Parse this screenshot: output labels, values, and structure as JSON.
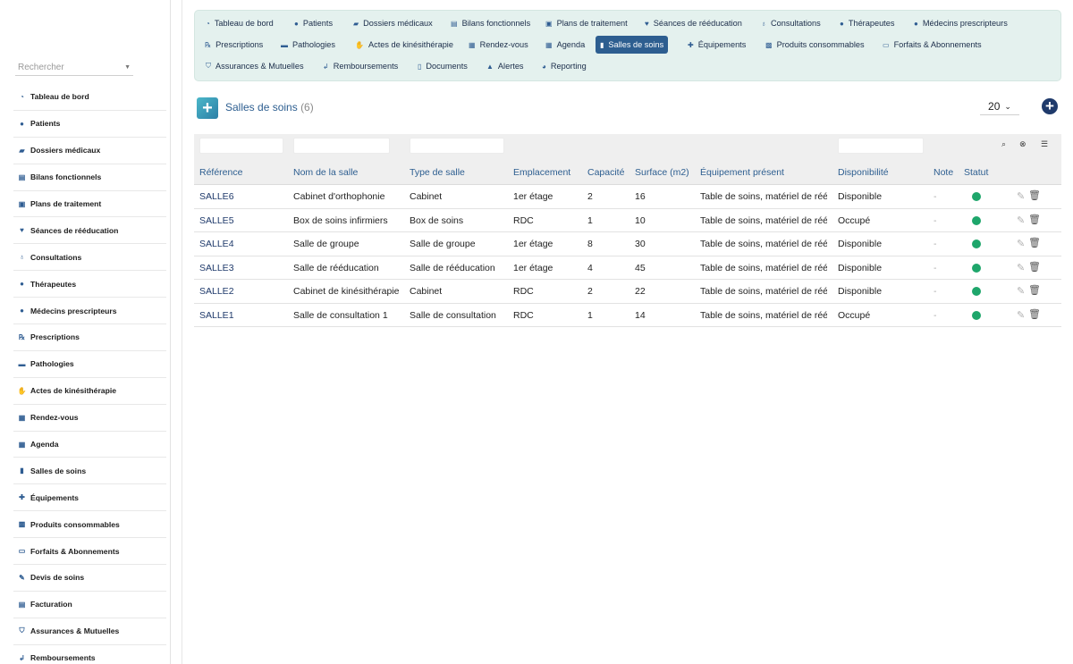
{
  "search": {
    "placeholder": "Rechercher"
  },
  "sidebar": {
    "items": [
      {
        "label": "Tableau de bord",
        "icon": "dashboard-icon",
        "glyph": "◔"
      },
      {
        "label": "Patients",
        "icon": "user-icon",
        "glyph": "●"
      },
      {
        "label": "Dossiers médicaux",
        "icon": "folder-open-icon",
        "glyph": "▰"
      },
      {
        "label": "Bilans fonctionnels",
        "icon": "clipboard-icon",
        "glyph": "▤"
      },
      {
        "label": "Plans de traitement",
        "icon": "clipboard-plus-icon",
        "glyph": "▣"
      },
      {
        "label": "Séances de rééducation",
        "icon": "heartbeat-icon",
        "glyph": "♥"
      },
      {
        "label": "Consultations",
        "icon": "stethoscope-icon",
        "glyph": "♁"
      },
      {
        "label": "Thérapeutes",
        "icon": "user-md-icon",
        "glyph": "●"
      },
      {
        "label": "Médecins prescripteurs",
        "icon": "user-md-icon",
        "glyph": "●"
      },
      {
        "label": "Prescriptions",
        "icon": "prescription-icon",
        "glyph": "℞"
      },
      {
        "label": "Pathologies",
        "icon": "procedures-icon",
        "glyph": "▬"
      },
      {
        "label": "Actes de kinésithérapie",
        "icon": "hands-icon",
        "glyph": "✋"
      },
      {
        "label": "Rendez-vous",
        "icon": "calendar-check-icon",
        "glyph": "▦"
      },
      {
        "label": "Agenda",
        "icon": "calendar-icon",
        "glyph": "▦"
      },
      {
        "label": "Salles de soins",
        "icon": "door-open-icon",
        "glyph": "▮"
      },
      {
        "label": "Équipements",
        "icon": "medkit-icon",
        "glyph": "✚"
      },
      {
        "label": "Produits consommables",
        "icon": "boxes-icon",
        "glyph": "▩"
      },
      {
        "label": "Forfaits & Abonnements",
        "icon": "ticket-icon",
        "glyph": "▭"
      },
      {
        "label": "Devis de soins",
        "icon": "invoice-icon",
        "glyph": "✎"
      },
      {
        "label": "Facturation",
        "icon": "file-invoice-icon",
        "glyph": "▤"
      },
      {
        "label": "Assurances & Mutuelles",
        "icon": "shield-icon",
        "glyph": "⛉"
      },
      {
        "label": "Remboursements",
        "icon": "hand-holding-icon",
        "glyph": "↲"
      }
    ]
  },
  "topmenu": {
    "items": [
      {
        "label": "Tableau de bord",
        "icon": "dashboard-icon",
        "glyph": "◔",
        "active": false
      },
      {
        "label": "Patients",
        "icon": "user-icon",
        "glyph": "●",
        "active": false
      },
      {
        "label": "Dossiers médicaux",
        "icon": "folder-open-icon",
        "glyph": "▰",
        "active": false
      },
      {
        "label": "Bilans fonctionnels",
        "icon": "clipboard-icon",
        "glyph": "▤",
        "active": false
      },
      {
        "label": "Plans de traitement",
        "icon": "clipboard-plus-icon",
        "glyph": "▣",
        "active": false
      },
      {
        "label": "Séances de rééducation",
        "icon": "heartbeat-icon",
        "glyph": "♥",
        "active": false
      },
      {
        "label": "Consultations",
        "icon": "stethoscope-icon",
        "glyph": "♁",
        "active": false
      },
      {
        "label": "Thérapeutes",
        "icon": "user-md-icon",
        "glyph": "●",
        "active": false
      },
      {
        "label": "Médecins prescripteurs",
        "icon": "user-md-icon",
        "glyph": "●",
        "active": false
      },
      {
        "label": "Prescriptions",
        "icon": "prescription-icon",
        "glyph": "℞",
        "active": false
      },
      {
        "label": "Pathologies",
        "icon": "procedures-icon",
        "glyph": "▬",
        "active": false
      },
      {
        "label": "Actes de kinésithérapie",
        "icon": "hands-icon",
        "glyph": "✋",
        "active": false
      },
      {
        "label": "Rendez-vous",
        "icon": "calendar-check-icon",
        "glyph": "▦",
        "active": false
      },
      {
        "label": "Agenda",
        "icon": "calendar-icon",
        "glyph": "▦",
        "active": false
      },
      {
        "label": "Salles de soins",
        "icon": "door-open-icon",
        "glyph": "▮",
        "active": true
      },
      {
        "label": "Équipements",
        "icon": "medkit-icon",
        "glyph": "✚",
        "active": false
      },
      {
        "label": "Produits consommables",
        "icon": "boxes-icon",
        "glyph": "▩",
        "active": false
      },
      {
        "label": "Forfaits & Abonnements",
        "icon": "ticket-icon",
        "glyph": "▭",
        "active": false
      },
      {
        "label": "Assurances & Mutuelles",
        "icon": "shield-icon",
        "glyph": "⛉",
        "active": false
      },
      {
        "label": "Remboursements",
        "icon": "hand-holding-icon",
        "glyph": "↲",
        "active": false
      },
      {
        "label": "Documents",
        "icon": "file-icon",
        "glyph": "▯",
        "active": false
      },
      {
        "label": "Alertes",
        "icon": "warning-icon",
        "glyph": "▲",
        "active": false
      },
      {
        "label": "Reporting",
        "icon": "chart-pie-icon",
        "glyph": "◕",
        "active": false
      }
    ]
  },
  "header": {
    "title": "Salles de soins",
    "count": "(6)",
    "per_page": "20",
    "colors": {
      "accent": "#2d5e90",
      "panel": "#e4f1ee",
      "status_green": "#1ea66b"
    }
  },
  "table": {
    "columns": [
      "Référence",
      "Nom de la salle",
      "Type de salle",
      "Emplacement",
      "Capacité",
      "Surface (m2)",
      "Équipement présent",
      "Disponibilité",
      "Note",
      "Statut"
    ],
    "rows": [
      {
        "ref": "SALLE6",
        "nom": "Cabinet d'orthophonie",
        "type": "Cabinet",
        "emplacement": "1er étage",
        "capacite": "2",
        "surface": "16",
        "equipement": "Table de soins, matériel de rééducation",
        "dispo": "Disponible",
        "note": "-"
      },
      {
        "ref": "SALLE5",
        "nom": "Box de soins infirmiers",
        "type": "Box de soins",
        "emplacement": "RDC",
        "capacite": "1",
        "surface": "10",
        "equipement": "Table de soins, matériel de rééducation",
        "dispo": "Occupé",
        "note": "-"
      },
      {
        "ref": "SALLE4",
        "nom": "Salle de groupe",
        "type": "Salle de groupe",
        "emplacement": "1er étage",
        "capacite": "8",
        "surface": "30",
        "equipement": "Table de soins, matériel de rééducation",
        "dispo": "Disponible",
        "note": "-"
      },
      {
        "ref": "SALLE3",
        "nom": "Salle de rééducation",
        "type": "Salle de rééducation",
        "emplacement": "1er étage",
        "capacite": "4",
        "surface": "45",
        "equipement": "Table de soins, matériel de rééducation",
        "dispo": "Disponible",
        "note": "-"
      },
      {
        "ref": "SALLE2",
        "nom": "Cabinet de kinésithérapie",
        "type": "Cabinet",
        "emplacement": "RDC",
        "capacite": "2",
        "surface": "22",
        "equipement": "Table de soins, matériel de rééducation",
        "dispo": "Disponible",
        "note": "-"
      },
      {
        "ref": "SALLE1",
        "nom": "Salle de consultation 1",
        "type": "Salle de consultation",
        "emplacement": "RDC",
        "capacite": "1",
        "surface": "14",
        "equipement": "Table de soins, matériel de rééducation",
        "dispo": "Occupé",
        "note": "-"
      }
    ]
  }
}
